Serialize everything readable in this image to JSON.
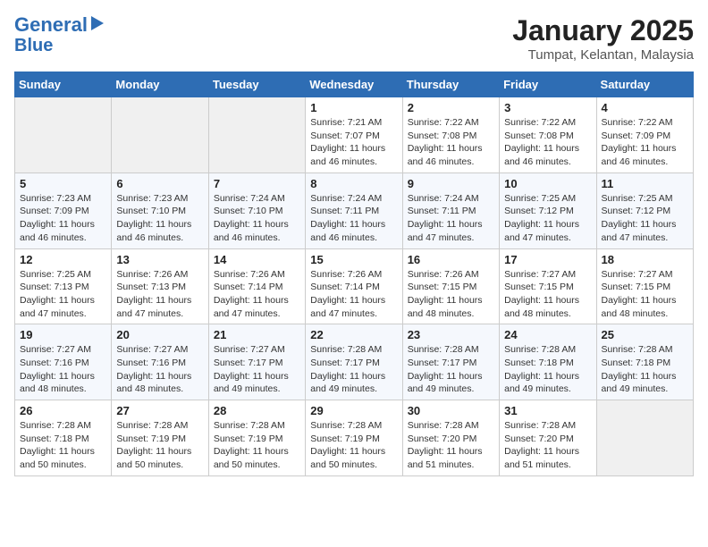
{
  "header": {
    "logo_line1": "General",
    "logo_line2": "Blue",
    "month_title": "January 2025",
    "location": "Tumpat, Kelantan, Malaysia"
  },
  "weekdays": [
    "Sunday",
    "Monday",
    "Tuesday",
    "Wednesday",
    "Thursday",
    "Friday",
    "Saturday"
  ],
  "weeks": [
    [
      {
        "day": "",
        "info": ""
      },
      {
        "day": "",
        "info": ""
      },
      {
        "day": "",
        "info": ""
      },
      {
        "day": "1",
        "info": "Sunrise: 7:21 AM\nSunset: 7:07 PM\nDaylight: 11 hours\nand 46 minutes."
      },
      {
        "day": "2",
        "info": "Sunrise: 7:22 AM\nSunset: 7:08 PM\nDaylight: 11 hours\nand 46 minutes."
      },
      {
        "day": "3",
        "info": "Sunrise: 7:22 AM\nSunset: 7:08 PM\nDaylight: 11 hours\nand 46 minutes."
      },
      {
        "day": "4",
        "info": "Sunrise: 7:22 AM\nSunset: 7:09 PM\nDaylight: 11 hours\nand 46 minutes."
      }
    ],
    [
      {
        "day": "5",
        "info": "Sunrise: 7:23 AM\nSunset: 7:09 PM\nDaylight: 11 hours\nand 46 minutes."
      },
      {
        "day": "6",
        "info": "Sunrise: 7:23 AM\nSunset: 7:10 PM\nDaylight: 11 hours\nand 46 minutes."
      },
      {
        "day": "7",
        "info": "Sunrise: 7:24 AM\nSunset: 7:10 PM\nDaylight: 11 hours\nand 46 minutes."
      },
      {
        "day": "8",
        "info": "Sunrise: 7:24 AM\nSunset: 7:11 PM\nDaylight: 11 hours\nand 46 minutes."
      },
      {
        "day": "9",
        "info": "Sunrise: 7:24 AM\nSunset: 7:11 PM\nDaylight: 11 hours\nand 47 minutes."
      },
      {
        "day": "10",
        "info": "Sunrise: 7:25 AM\nSunset: 7:12 PM\nDaylight: 11 hours\nand 47 minutes."
      },
      {
        "day": "11",
        "info": "Sunrise: 7:25 AM\nSunset: 7:12 PM\nDaylight: 11 hours\nand 47 minutes."
      }
    ],
    [
      {
        "day": "12",
        "info": "Sunrise: 7:25 AM\nSunset: 7:13 PM\nDaylight: 11 hours\nand 47 minutes."
      },
      {
        "day": "13",
        "info": "Sunrise: 7:26 AM\nSunset: 7:13 PM\nDaylight: 11 hours\nand 47 minutes."
      },
      {
        "day": "14",
        "info": "Sunrise: 7:26 AM\nSunset: 7:14 PM\nDaylight: 11 hours\nand 47 minutes."
      },
      {
        "day": "15",
        "info": "Sunrise: 7:26 AM\nSunset: 7:14 PM\nDaylight: 11 hours\nand 47 minutes."
      },
      {
        "day": "16",
        "info": "Sunrise: 7:26 AM\nSunset: 7:15 PM\nDaylight: 11 hours\nand 48 minutes."
      },
      {
        "day": "17",
        "info": "Sunrise: 7:27 AM\nSunset: 7:15 PM\nDaylight: 11 hours\nand 48 minutes."
      },
      {
        "day": "18",
        "info": "Sunrise: 7:27 AM\nSunset: 7:15 PM\nDaylight: 11 hours\nand 48 minutes."
      }
    ],
    [
      {
        "day": "19",
        "info": "Sunrise: 7:27 AM\nSunset: 7:16 PM\nDaylight: 11 hours\nand 48 minutes."
      },
      {
        "day": "20",
        "info": "Sunrise: 7:27 AM\nSunset: 7:16 PM\nDaylight: 11 hours\nand 48 minutes."
      },
      {
        "day": "21",
        "info": "Sunrise: 7:27 AM\nSunset: 7:17 PM\nDaylight: 11 hours\nand 49 minutes."
      },
      {
        "day": "22",
        "info": "Sunrise: 7:28 AM\nSunset: 7:17 PM\nDaylight: 11 hours\nand 49 minutes."
      },
      {
        "day": "23",
        "info": "Sunrise: 7:28 AM\nSunset: 7:17 PM\nDaylight: 11 hours\nand 49 minutes."
      },
      {
        "day": "24",
        "info": "Sunrise: 7:28 AM\nSunset: 7:18 PM\nDaylight: 11 hours\nand 49 minutes."
      },
      {
        "day": "25",
        "info": "Sunrise: 7:28 AM\nSunset: 7:18 PM\nDaylight: 11 hours\nand 49 minutes."
      }
    ],
    [
      {
        "day": "26",
        "info": "Sunrise: 7:28 AM\nSunset: 7:18 PM\nDaylight: 11 hours\nand 50 minutes."
      },
      {
        "day": "27",
        "info": "Sunrise: 7:28 AM\nSunset: 7:19 PM\nDaylight: 11 hours\nand 50 minutes."
      },
      {
        "day": "28",
        "info": "Sunrise: 7:28 AM\nSunset: 7:19 PM\nDaylight: 11 hours\nand 50 minutes."
      },
      {
        "day": "29",
        "info": "Sunrise: 7:28 AM\nSunset: 7:19 PM\nDaylight: 11 hours\nand 50 minutes."
      },
      {
        "day": "30",
        "info": "Sunrise: 7:28 AM\nSunset: 7:20 PM\nDaylight: 11 hours\nand 51 minutes."
      },
      {
        "day": "31",
        "info": "Sunrise: 7:28 AM\nSunset: 7:20 PM\nDaylight: 11 hours\nand 51 minutes."
      },
      {
        "day": "",
        "info": ""
      }
    ]
  ]
}
